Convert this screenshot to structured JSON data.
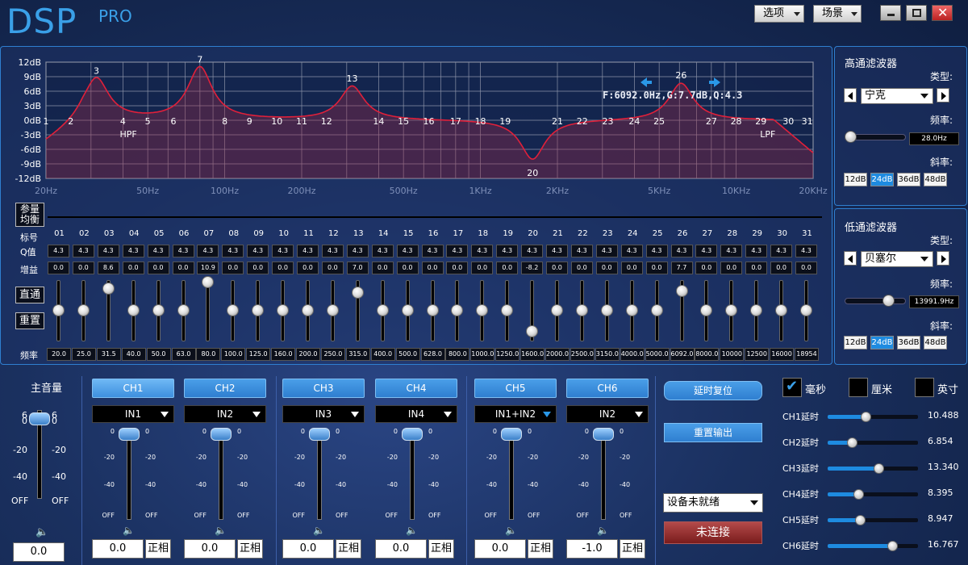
{
  "header": {
    "brand": "DSP",
    "brand_sub": "PRO",
    "options_label": "选项",
    "scene_label": "场景"
  },
  "graph": {
    "y_ticks": [
      "12dB",
      "9dB",
      "6dB",
      "3dB",
      "0dB",
      "-3dB",
      "-6dB",
      "-9dB",
      "-12dB"
    ],
    "x_ticks": [
      "20Hz",
      "50Hz",
      "100Hz",
      "200Hz",
      "500Hz",
      "1KHz",
      "2KHz",
      "5KHz",
      "10KHz",
      "20KHz"
    ],
    "readout": "F:6092.0Hz,G:7.7dB,Q:4.3",
    "hpf_label": "HPF",
    "lpf_label": "LPF"
  },
  "mode_buttons": {
    "param_eq": "参量均衡",
    "bypass": "直通",
    "reset": "重置"
  },
  "row_labels": {
    "band": "标号",
    "q": "Q值",
    "gain": "增益",
    "freq": "频率"
  },
  "bands": [
    {
      "id": "01",
      "q": "4.3",
      "gain": "0.0",
      "freq": "20.0"
    },
    {
      "id": "02",
      "q": "4.3",
      "gain": "0.0",
      "freq": "25.0"
    },
    {
      "id": "03",
      "q": "4.3",
      "gain": "8.6",
      "freq": "31.5"
    },
    {
      "id": "04",
      "q": "4.3",
      "gain": "0.0",
      "freq": "40.0"
    },
    {
      "id": "05",
      "q": "4.3",
      "gain": "0.0",
      "freq": "50.0"
    },
    {
      "id": "06",
      "q": "4.3",
      "gain": "0.0",
      "freq": "63.0"
    },
    {
      "id": "07",
      "q": "4.3",
      "gain": "10.9",
      "freq": "80.0"
    },
    {
      "id": "08",
      "q": "4.3",
      "gain": "0.0",
      "freq": "100.0"
    },
    {
      "id": "09",
      "q": "4.3",
      "gain": "0.0",
      "freq": "125.0"
    },
    {
      "id": "10",
      "q": "4.3",
      "gain": "0.0",
      "freq": "160.0"
    },
    {
      "id": "11",
      "q": "4.3",
      "gain": "0.0",
      "freq": "200.0"
    },
    {
      "id": "12",
      "q": "4.3",
      "gain": "0.0",
      "freq": "250.0"
    },
    {
      "id": "13",
      "q": "4.3",
      "gain": "7.0",
      "freq": "315.0"
    },
    {
      "id": "14",
      "q": "4.3",
      "gain": "0.0",
      "freq": "400.0"
    },
    {
      "id": "15",
      "q": "4.3",
      "gain": "0.0",
      "freq": "500.0"
    },
    {
      "id": "16",
      "q": "4.3",
      "gain": "0.0",
      "freq": "628.0"
    },
    {
      "id": "17",
      "q": "4.3",
      "gain": "0.0",
      "freq": "800.0"
    },
    {
      "id": "18",
      "q": "4.3",
      "gain": "0.0",
      "freq": "1000.0"
    },
    {
      "id": "19",
      "q": "4.3",
      "gain": "0.0",
      "freq": "1250.0"
    },
    {
      "id": "20",
      "q": "4.3",
      "gain": "-8.2",
      "freq": "1600.0"
    },
    {
      "id": "21",
      "q": "4.3",
      "gain": "0.0",
      "freq": "2000.0"
    },
    {
      "id": "22",
      "q": "4.3",
      "gain": "0.0",
      "freq": "2500.0"
    },
    {
      "id": "23",
      "q": "4.3",
      "gain": "0.0",
      "freq": "3150.0"
    },
    {
      "id": "24",
      "q": "4.3",
      "gain": "0.0",
      "freq": "4000.0"
    },
    {
      "id": "25",
      "q": "4.3",
      "gain": "0.0",
      "freq": "5000.0"
    },
    {
      "id": "26",
      "q": "4.3",
      "gain": "7.7",
      "freq": "6092.0"
    },
    {
      "id": "27",
      "q": "4.3",
      "gain": "0.0",
      "freq": "8000.0"
    },
    {
      "id": "28",
      "q": "4.3",
      "gain": "0.0",
      "freq": "10000"
    },
    {
      "id": "29",
      "q": "4.3",
      "gain": "0.0",
      "freq": "12500"
    },
    {
      "id": "30",
      "q": "4.3",
      "gain": "0.0",
      "freq": "16000"
    },
    {
      "id": "31",
      "q": "4.3",
      "gain": "0.0",
      "freq": "18954"
    }
  ],
  "graph_band_labels": [
    "1",
    "2",
    "3",
    "4",
    "5",
    "6",
    "7",
    "8",
    "9",
    "10",
    "11",
    "12",
    "13",
    "14",
    "15",
    "16",
    "17",
    "18",
    "19",
    "20",
    "21",
    "22",
    "23",
    "24",
    "25",
    "26",
    "27",
    "28",
    "29",
    "30",
    "31"
  ],
  "hpf": {
    "title": "高通滤波器",
    "type_label": "类型:",
    "type_value": "宁克",
    "freq_label": "频率:",
    "freq_value": "28.0Hz",
    "freq_level": 0.02,
    "slope_label": "斜率:",
    "slopes": [
      "12dB",
      "24dB",
      "36dB",
      "48dB"
    ],
    "slope_selected": "24dB"
  },
  "lpf": {
    "title": "低通滤波器",
    "type_label": "类型:",
    "type_value": "贝塞尔",
    "freq_label": "频率:",
    "freq_value": "13991.9Hz",
    "freq_level": 0.8,
    "slope_label": "斜率:",
    "slopes": [
      "12dB",
      "24dB",
      "36dB",
      "48dB"
    ],
    "slope_selected": "24dB"
  },
  "master": {
    "title": "主音量",
    "value": "0.0",
    "scale": [
      "6",
      "0",
      "-20",
      "-40",
      "OFF"
    ]
  },
  "channels": [
    {
      "name": "CH1",
      "input": "IN1",
      "value": "0.0",
      "phase": "正相"
    },
    {
      "name": "CH2",
      "input": "IN2",
      "value": "0.0",
      "phase": "正相"
    },
    {
      "name": "CH3",
      "input": "IN3",
      "value": "0.0",
      "phase": "正相"
    },
    {
      "name": "CH4",
      "input": "IN4",
      "value": "0.0",
      "phase": "正相"
    },
    {
      "name": "CH5",
      "input": "IN1+IN2",
      "value": "0.0",
      "phase": "正相"
    },
    {
      "name": "CH6",
      "input": "IN2",
      "value": "-1.0",
      "phase": "正相"
    }
  ],
  "channel_scale": [
    "0",
    "-20",
    "-40",
    "OFF"
  ],
  "actions": {
    "delay_reset": "延时复位",
    "reset_output": "重置输出",
    "device_status": "设备未就绪",
    "connect": "未连接"
  },
  "delay": {
    "units": [
      "毫秒",
      "厘米",
      "英寸"
    ],
    "unit_checked": "毫秒",
    "rows": [
      {
        "label": "CH1延时",
        "value": "10.488",
        "level": 0.42
      },
      {
        "label": "CH2延时",
        "value": "6.854",
        "level": 0.27
      },
      {
        "label": "CH3延时",
        "value": "13.340",
        "level": 0.56
      },
      {
        "label": "CH4延时",
        "value": "8.395",
        "level": 0.34
      },
      {
        "label": "CH5延时",
        "value": "8.947",
        "level": 0.36
      },
      {
        "label": "CH6延时",
        "value": "16.767",
        "level": 0.71
      }
    ]
  }
}
